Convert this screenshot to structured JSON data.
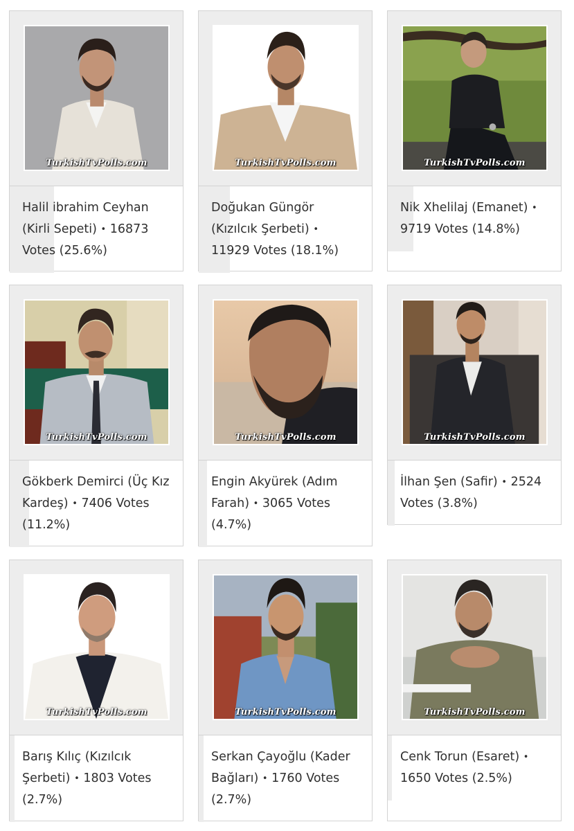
{
  "watermark": "TurkishTvPolls.com",
  "separator": "•",
  "cards": [
    {
      "name": "Halil ibrahim Ceyhan",
      "show": "(Kirli Sepeti)",
      "votes": "16873 Votes",
      "pct": "(25.6%)",
      "pct_value": 25.6
    },
    {
      "name": "Doğukan Güngör",
      "show": "(Kızılcık Şerbeti)",
      "votes": "11929 Votes",
      "pct": "(18.1%)",
      "pct_value": 18.1
    },
    {
      "name": "Nik Xhelilaj",
      "show": "(Emanet)",
      "votes": "9719 Votes",
      "pct": "(14.8%)",
      "pct_value": 14.8
    },
    {
      "name": "Gökberk Demirci",
      "show": "(Üç Kız Kardeş)",
      "votes": "7406 Votes",
      "pct": "(11.2%)",
      "pct_value": 11.2
    },
    {
      "name": "Engin Akyürek",
      "show": "(Adım Farah)",
      "votes": "3065 Votes",
      "pct": "(4.7%)",
      "pct_value": 4.7
    },
    {
      "name": "İlhan Şen",
      "show": "(Safir)",
      "votes": "2524 Votes",
      "pct": "(3.8%)",
      "pct_value": 3.8
    },
    {
      "name": "Barış Kılıç",
      "show": "(Kızılcık Şerbeti)",
      "votes": "1803 Votes",
      "pct": "(2.7%)",
      "pct_value": 2.7
    },
    {
      "name": "Serkan Çayoğlu",
      "show": "(Kader Bağları)",
      "votes": "1760 Votes",
      "pct": "(2.7%)",
      "pct_value": 2.7
    },
    {
      "name": "Cenk Torun",
      "show": "(Esaret)",
      "votes": "1650 Votes",
      "pct": "(2.5%)",
      "pct_value": 2.5
    }
  ],
  "colors": {
    "card_bg": "#ffffff",
    "photo_frame_bg": "#ededed",
    "border": "#d3d3d3",
    "bar": "#ececec",
    "text": "#2f2f2f"
  }
}
